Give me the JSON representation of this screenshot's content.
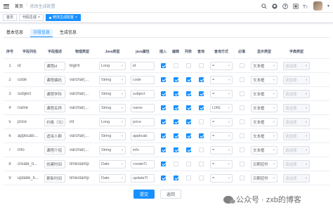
{
  "breadcrumb": {
    "home": "首页",
    "sep": "/",
    "current": "修改生成配置"
  },
  "header": {
    "icons": [
      "search-icon",
      "github-icon",
      "question-icon",
      "fullscreen-icon",
      "font-size-icon"
    ]
  },
  "tags": [
    {
      "label": "首页",
      "active": false
    },
    {
      "label": "代码生成",
      "active": false,
      "close": "×"
    },
    {
      "label": "修改生成配置",
      "active": true,
      "close": "×"
    }
  ],
  "tabs": [
    {
      "label": "基本信息",
      "active": false
    },
    {
      "label": "字段信息",
      "active": true
    },
    {
      "label": "生成信息",
      "active": false
    }
  ],
  "table": {
    "headers": [
      "序号",
      "字段列名",
      "字段描述",
      "物理类型",
      "Java类型",
      "java属性",
      "插入",
      "编辑",
      "列表",
      "查询",
      "查询方式",
      "必填",
      "显示类型",
      "字典类型"
    ],
    "rows": [
      {
        "idx": "1",
        "col": "id",
        "desc": "课程id",
        "type": "bigint",
        "jtype": "Long",
        "jattr": "id",
        "checks": [
          true,
          false,
          false,
          false
        ],
        "query": "=",
        "req": false,
        "disp": "文本框",
        "dict": "请选择"
      },
      {
        "idx": "2",
        "col": "code",
        "desc": "课程编码",
        "type": "varchar(...",
        "jtype": "String",
        "jattr": "code",
        "checks": [
          true,
          true,
          true,
          true
        ],
        "query": "=",
        "req": false,
        "disp": "文本框",
        "dict": "请选择"
      },
      {
        "idx": "3",
        "col": "subject",
        "desc": "课程学科",
        "type": "varchar(...",
        "jtype": "String",
        "jattr": "subject",
        "checks": [
          true,
          true,
          true,
          true
        ],
        "query": "=",
        "req": false,
        "disp": "文本框",
        "dict": "请选择"
      },
      {
        "idx": "4",
        "col": "name",
        "desc": "课程名称",
        "type": "varchar(...",
        "jtype": "String",
        "jattr": "name",
        "checks": [
          true,
          true,
          true,
          true
        ],
        "query": "LIKE",
        "req": false,
        "disp": "文本框",
        "dict": "请选择"
      },
      {
        "idx": "5",
        "col": "price",
        "desc": "价格（元）",
        "type": "int",
        "jtype": "Long",
        "jattr": "price",
        "checks": [
          true,
          true,
          true,
          false
        ],
        "query": "=",
        "req": false,
        "disp": "文本框",
        "dict": "请选择"
      },
      {
        "idx": "6",
        "col": "applicabl...",
        "desc": "适用人群",
        "type": "varchar(...",
        "jtype": "String",
        "jattr": "applicab",
        "checks": [
          true,
          true,
          true,
          true
        ],
        "query": "=",
        "req": false,
        "disp": "文本框",
        "dict": "请选择"
      },
      {
        "idx": "7",
        "col": "info",
        "desc": "课程介绍",
        "type": "varchar(...",
        "jtype": "String",
        "jattr": "info",
        "checks": [
          true,
          true,
          true,
          false
        ],
        "query": "=",
        "req": false,
        "disp": "文本框",
        "dict": "请选择"
      },
      {
        "idx": "8",
        "col": "create_ti...",
        "desc": "创建时间",
        "type": "timestamp",
        "jtype": "Date",
        "jattr": "createTi",
        "checks": [
          true,
          false,
          false,
          false
        ],
        "query": "=",
        "req": false,
        "disp": "日期控件",
        "dict": "请选择"
      },
      {
        "idx": "9",
        "col": "update_ti...",
        "desc": "更新时间",
        "type": "timestamp",
        "jtype": "Date",
        "jattr": "updateTi",
        "checks": [
          true,
          true,
          false,
          false
        ],
        "query": "=",
        "req": false,
        "disp": "日期控件",
        "dict": "请选择"
      }
    ]
  },
  "buttons": {
    "submit": "提交",
    "back": "返回"
  },
  "watermark": {
    "text": "公众号 · zxb的博客"
  },
  "colors": {
    "primary": "#1890ff",
    "border": "#dcdfe6"
  }
}
